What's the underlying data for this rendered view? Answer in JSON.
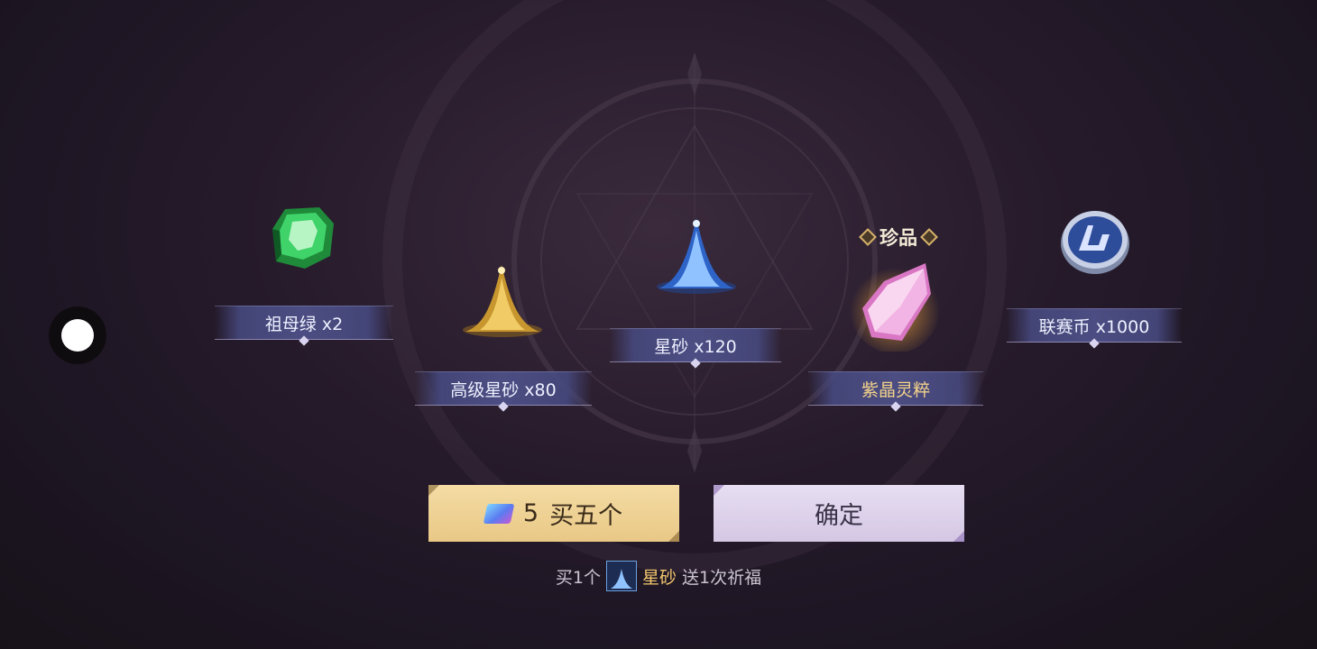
{
  "rewards": [
    {
      "name": "祖母绿 x2",
      "icon": "emerald-icon"
    },
    {
      "name": "高级星砂 x80",
      "icon": "gold-stardust-icon"
    },
    {
      "name": "星砂 x120",
      "icon": "blue-stardust-icon"
    },
    {
      "name": "紫晶灵粹",
      "icon": "purple-crystal-icon",
      "tag": "珍品",
      "accent": "#f2c76e"
    },
    {
      "name": "联赛币 x1000",
      "icon": "league-coin-icon"
    }
  ],
  "buttons": {
    "buy_count": "5",
    "buy_label": "买五个",
    "confirm_label": "确定"
  },
  "footer": {
    "prefix": "买1个",
    "item": "星砂",
    "suffix": "送1次祈福"
  },
  "colors": {
    "buy_button": "#eed293",
    "confirm_button": "#ddd2ea",
    "highlight": "#f2c76e"
  }
}
